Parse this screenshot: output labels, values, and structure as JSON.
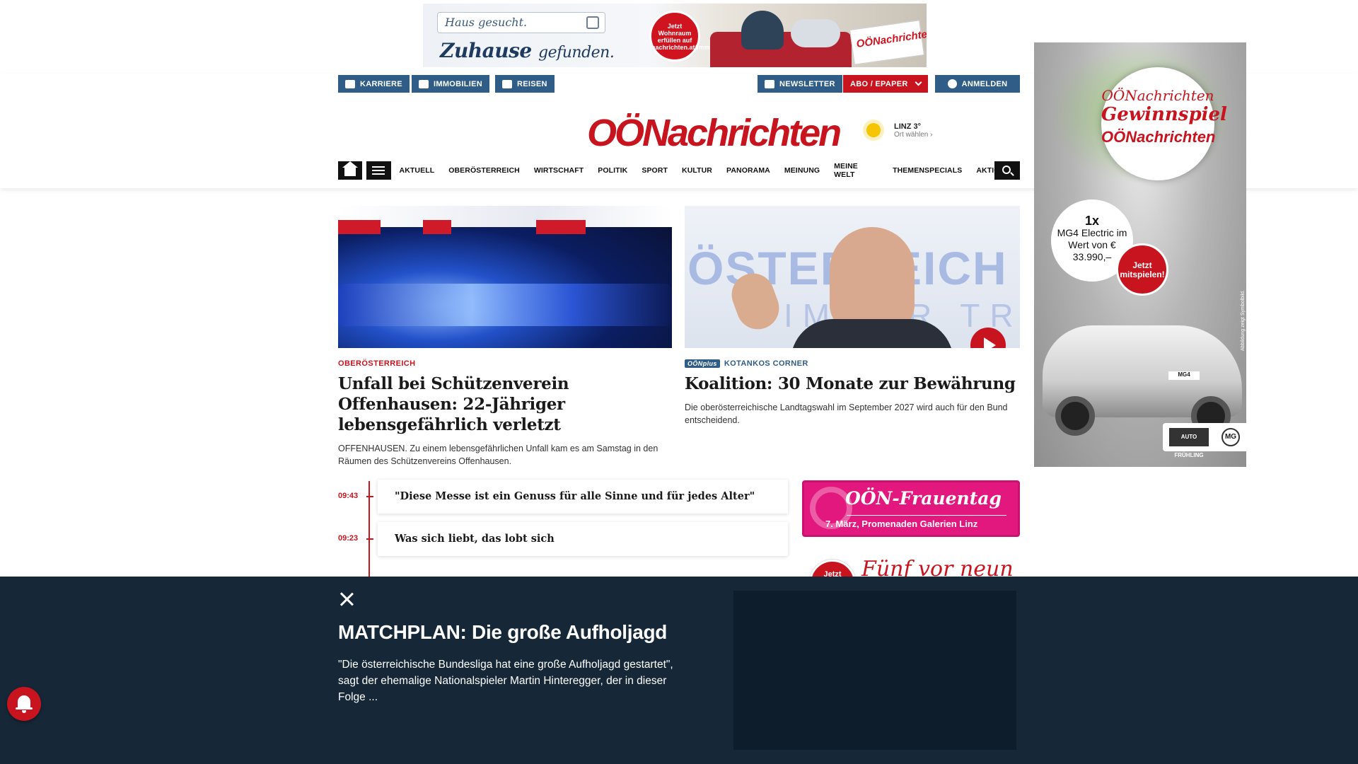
{
  "top_ad": {
    "search_placeholder": "Haus gesucht.",
    "slogan_main": "Zuhause",
    "slogan_small": "gefunden.",
    "badge": "Jetzt Wohnraum erfüllen auf nachrichten.at/immobilien",
    "paper_brand": "OÖNachrichten"
  },
  "header": {
    "buttons_left": [
      "KARRIERE",
      "IMMOBILIEN",
      "REISEN"
    ],
    "newsletter": "NEWSLETTER",
    "abo": "ABO / EPAPER",
    "login": "ANMELDEN",
    "logo": "OÖNachrichten",
    "weather_city": "LINZ 3°",
    "weather_sub": "Ort wählen",
    "nav_items": [
      "AKTUELL",
      "OBERÖSTERREICH",
      "WIRTSCHAFT",
      "POLITIK",
      "SPORT",
      "KULTUR",
      "PANORAMA",
      "MEINUNG",
      "MEINE WELT",
      "THEMENSPECIALS",
      "AKTIONEN"
    ]
  },
  "sky_ad": {
    "line1": "OÖNachrichten",
    "line2": "Gewinnspiel",
    "paper": "OÖNachrichten",
    "prize_big": "1x",
    "prize_text": "MG4 Electric im Wert von € 33.990,–",
    "cta": "Jetzt mitspielen!",
    "plate": "MG4",
    "brand1": "AUTO FRÜHLING",
    "brand2": "MG",
    "disclaimer": "Abbildung zeigt Symbolbild."
  },
  "articles": [
    {
      "kicker": "OBERÖSTERREICH",
      "title": "Unfall bei Schützenverein Offenhausen: 22-Jähriger lebensgefährlich verletzt",
      "teaser": "OFFENHAUSEN. Zu einem lebensgefährlichen Unfall kam es am Samstag in den Räumen des Schützenvereins Offenhausen."
    },
    {
      "plus_badge": "OÖNplus",
      "kicker": "KOTANKOS CORNER",
      "image_text1": "ÖSTERREICH",
      "image_text2": "IMMER TREU",
      "title": "Koalition: 30 Monate zur Bewährung",
      "teaser": "Die oberösterreichische Landtagswahl im September 2027 wird auch für den Bund entscheidend."
    }
  ],
  "ticker": [
    {
      "time": "09:43",
      "title": "\"Diese Messe ist ein Genuss für alle Sinne und für jedes Alter\""
    },
    {
      "time": "09:23",
      "title": "Was sich liebt, das lobt sich"
    }
  ],
  "promo_frauentag": {
    "title": "OÖN-Frauentag",
    "sub": "7. März, Promenaden Galerien Linz"
  },
  "promo_fuenf": {
    "badge": "Jetzt",
    "title": "Fünf vor neun"
  },
  "overlay": {
    "title": "MATCHPLAN: Die große Aufholjagd",
    "description": "\"Die österreichische Bundesliga hat eine große Aufholjagd gestartet\", sagt der ehemalige Nationalspieler Martin Hinteregger, der in dieser Folge ..."
  },
  "colors": {
    "brand_red": "#c8141e",
    "nav_blue": "#2f5d87",
    "overlay_bg": "#162838"
  }
}
